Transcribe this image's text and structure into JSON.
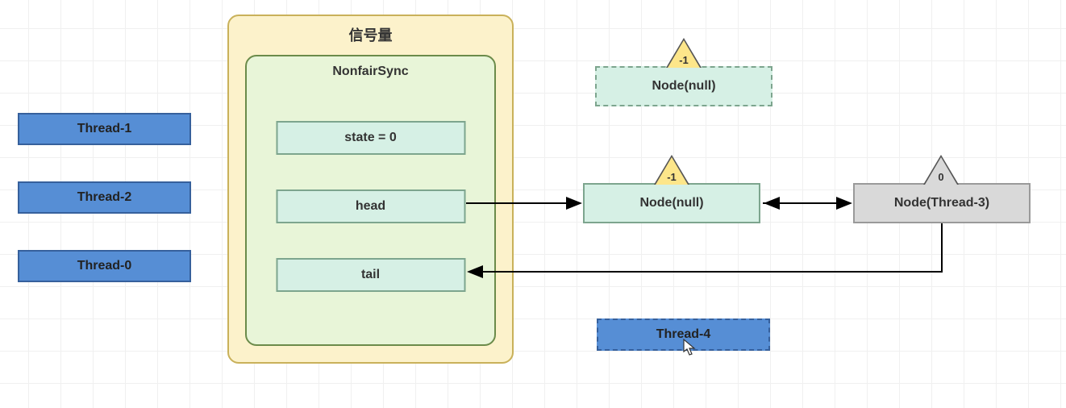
{
  "threads": {
    "t1": "Thread-1",
    "t2": "Thread-2",
    "t0": "Thread-0",
    "t4": "Thread-4"
  },
  "semaphore": {
    "title": "信号量",
    "sync_title": "NonfairSync",
    "state_label": "state = 0",
    "head_label": "head",
    "tail_label": "tail"
  },
  "nodes": {
    "dashed_null": {
      "label": "Node(null)",
      "wait_status": "-1"
    },
    "head_null": {
      "label": "Node(null)",
      "wait_status": "-1"
    },
    "thread3": {
      "label": "Node(Thread-3)",
      "wait_status": "0"
    }
  }
}
